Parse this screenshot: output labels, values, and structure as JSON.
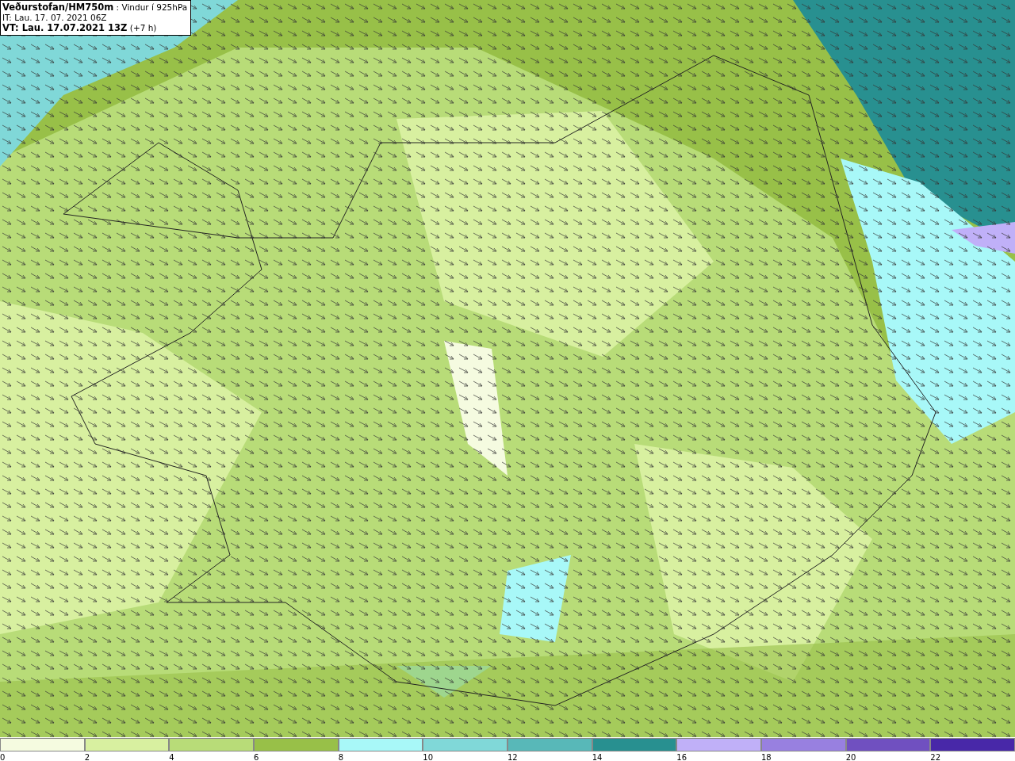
{
  "header": {
    "lines": [
      "**Veðurstofan/HM750m** : Vindur í 925hPa",
      "IT: Lau. 17. 07. 2021 06Z",
      "**VT: Lau. 17.07.2021 13Z** (+7 h)"
    ]
  },
  "legend": {
    "swatches": [
      {
        "color": "#f5fbe0",
        "label": "0"
      },
      {
        "color": "#d8f0a0",
        "label": "2"
      },
      {
        "color": "#b8dc78",
        "label": "4"
      },
      {
        "color": "#98c048",
        "label": "6"
      },
      {
        "color": "#a8f8f8",
        "label": "8"
      },
      {
        "color": "#80d8d8",
        "label": "10"
      },
      {
        "color": "#58b8b8",
        "label": "12"
      },
      {
        "color": "#289090",
        "label": "14"
      },
      {
        "color": "#c0b0f8",
        "label": "16"
      },
      {
        "color": "#9880e0",
        "label": "18"
      },
      {
        "color": "#7050c0",
        "label": "20"
      },
      {
        "color": "#4828a8",
        "label": "22"
      }
    ]
  }
}
